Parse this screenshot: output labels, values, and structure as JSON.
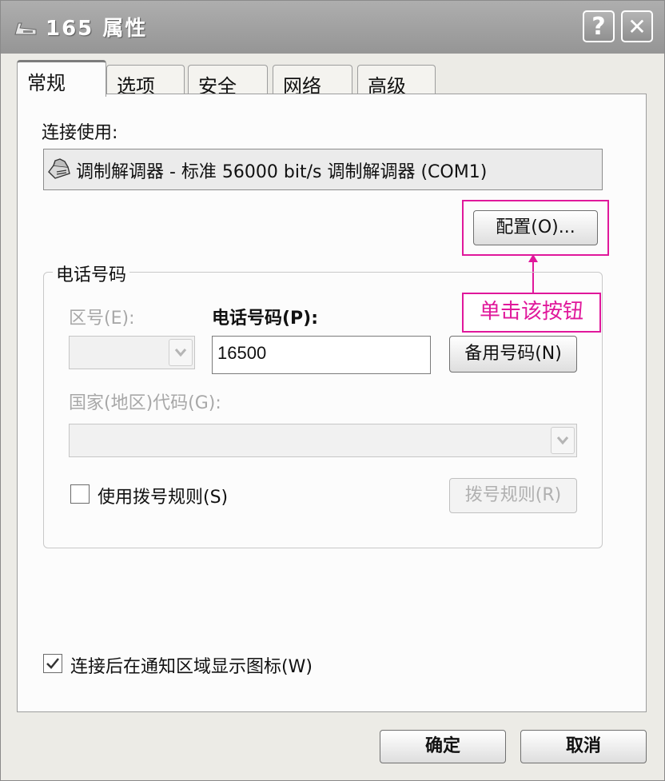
{
  "window": {
    "title": "165 属性",
    "help_label": "?",
    "close_label": "✕",
    "app_icon": "modem-icon"
  },
  "tabs": [
    {
      "label": "常规",
      "active": true
    },
    {
      "label": "选项",
      "active": false
    },
    {
      "label": "安全",
      "active": false
    },
    {
      "label": "网络",
      "active": false
    },
    {
      "label": "高级",
      "active": false
    }
  ],
  "connect_using": {
    "label": "连接使用:",
    "device": "调制解调器 - 标准 56000 bit/s 调制解调器 (COM1)",
    "device_icon": "modem-icon",
    "configure_button": "配置(O)..."
  },
  "annotation": {
    "callout_text": "单击该按钮",
    "color": "#e0189b"
  },
  "phone_number": {
    "group_title": "电话号码",
    "area_code_label": "区号(E):",
    "area_code_value": "",
    "phone_label": "电话号码(P):",
    "phone_value": "16500",
    "alternates_button": "备用号码(N)",
    "country_label": "国家(地区)代码(G):",
    "country_value": "",
    "use_dialing_rules_label": "使用拨号规则(S)",
    "use_dialing_rules_checked": false,
    "dialing_rules_button": "拨号规则(R)"
  },
  "notify": {
    "label": "连接后在通知区域显示图标(W)",
    "checked": true
  },
  "footer": {
    "ok": "确定",
    "cancel": "取消"
  }
}
